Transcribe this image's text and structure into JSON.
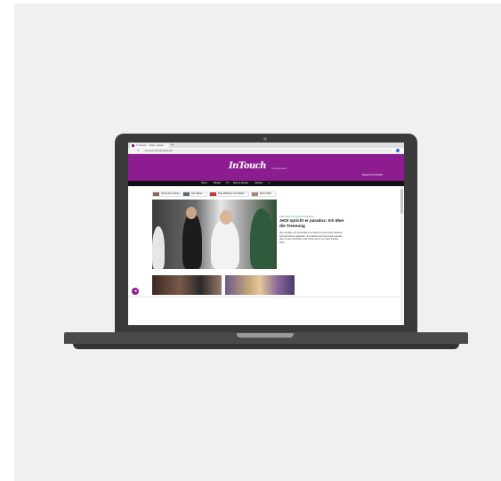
{
  "browser": {
    "tab_title": "In Touch – Stars, News",
    "new_tab": "+",
    "back": "‹",
    "forward": "›",
    "reload": "↻",
    "url": "intouch.wunderweib.de"
  },
  "site": {
    "logo": "InTouch",
    "logo_tag": "by wunderweib",
    "header_links": "Magazine  Newsletter",
    "brand_color": "#8c1c8f",
    "nav": [
      "Home",
      "Royals",
      "TV",
      "Stars & Society",
      "Lifestyle",
      "▾"
    ],
    "trends": [
      "Tschechien Hanne",
      "Zwei Mikes",
      "Kate Middleton und Wiliam",
      "Pietro Shiro"
    ],
    "hero": {
      "kicker": "Fürst Albert & Fürstin Charlène",
      "headline": "Jetzt spricht er paradox: Ich über die Trennung",
      "teaser": "Über die Ehe von Fürst Albert von Monaco und Fürstin Charlène wird seit Jahren spekuliert. Jetzt äußert sich der Royal erstmals offen zu den Gerüchten und verrät, wie es um seine Familie steht."
    },
    "scroll_button": "◂"
  }
}
